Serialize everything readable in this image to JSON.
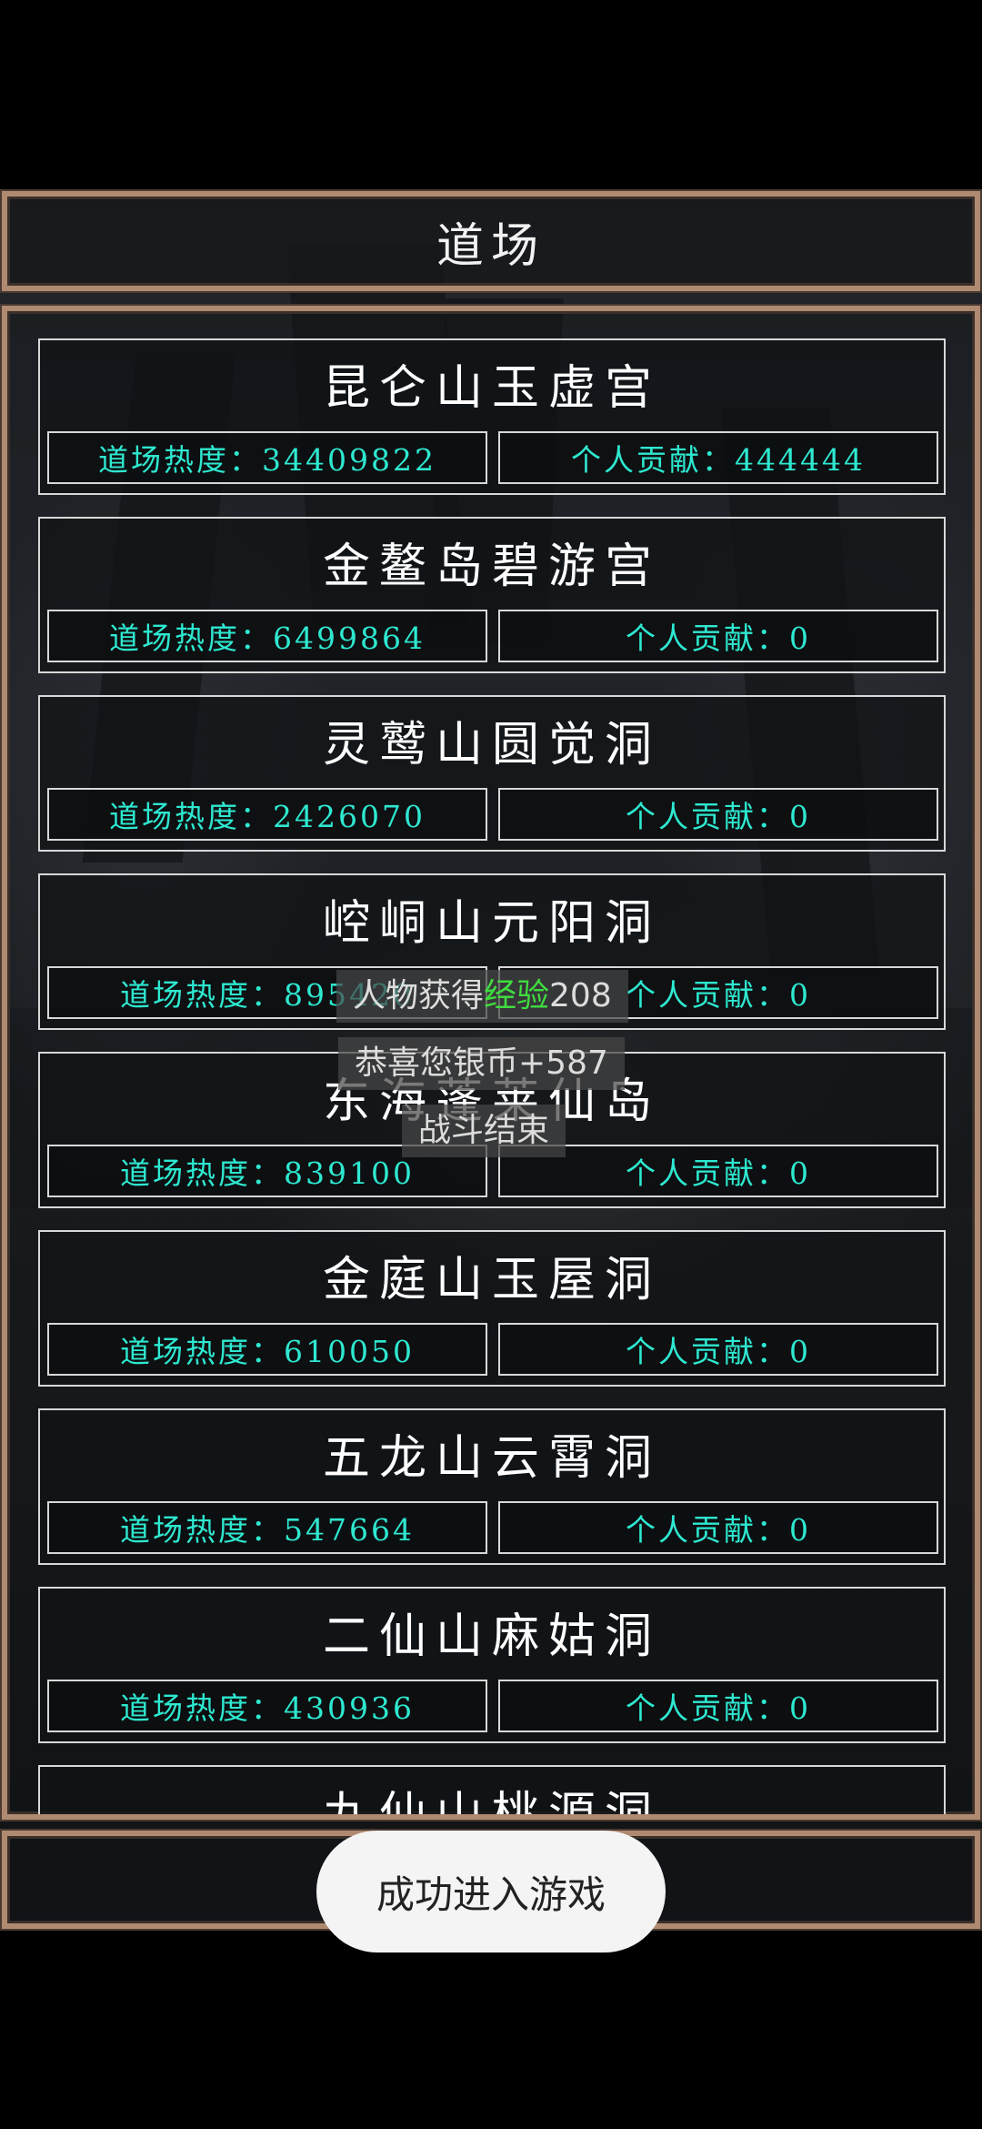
{
  "header": {
    "title": "道场"
  },
  "dojos": [
    {
      "name": "昆仑山玉虚宫",
      "heat": "道场热度：34409822",
      "contribution": "个人贡献：444444"
    },
    {
      "name": "金鳌岛碧游宫",
      "heat": "道场热度：6499864",
      "contribution": "个人贡献：0"
    },
    {
      "name": "灵鹫山圆觉洞",
      "heat": "道场热度：2426070",
      "contribution": "个人贡献：0"
    },
    {
      "name": "崆峒山元阳洞",
      "heat": "道场热度：895420",
      "contribution": "个人贡献：0"
    },
    {
      "name": "东海蓬莱仙岛",
      "heat": "道场热度：839100",
      "contribution": "个人贡献：0"
    },
    {
      "name": "金庭山玉屋洞",
      "heat": "道场热度：610050",
      "contribution": "个人贡献：0"
    },
    {
      "name": "五龙山云霄洞",
      "heat": "道场热度：547664",
      "contribution": "个人贡献：0"
    },
    {
      "name": "二仙山麻姑洞",
      "heat": "道场热度：430936",
      "contribution": "个人贡献：0"
    },
    {
      "name": "九仙山桃源洞"
    }
  ],
  "toasts": {
    "exp_prefix": "人物获得",
    "exp_highlight": "经验",
    "exp_value": "208",
    "silver": "恭喜您银币+587",
    "battle_end": "战斗结束"
  },
  "system_toast": "成功进入游戏",
  "colors": {
    "stat_text": "#2ee8d0",
    "frame": "#b08a70",
    "exp_highlight": "#3fdc3f"
  }
}
